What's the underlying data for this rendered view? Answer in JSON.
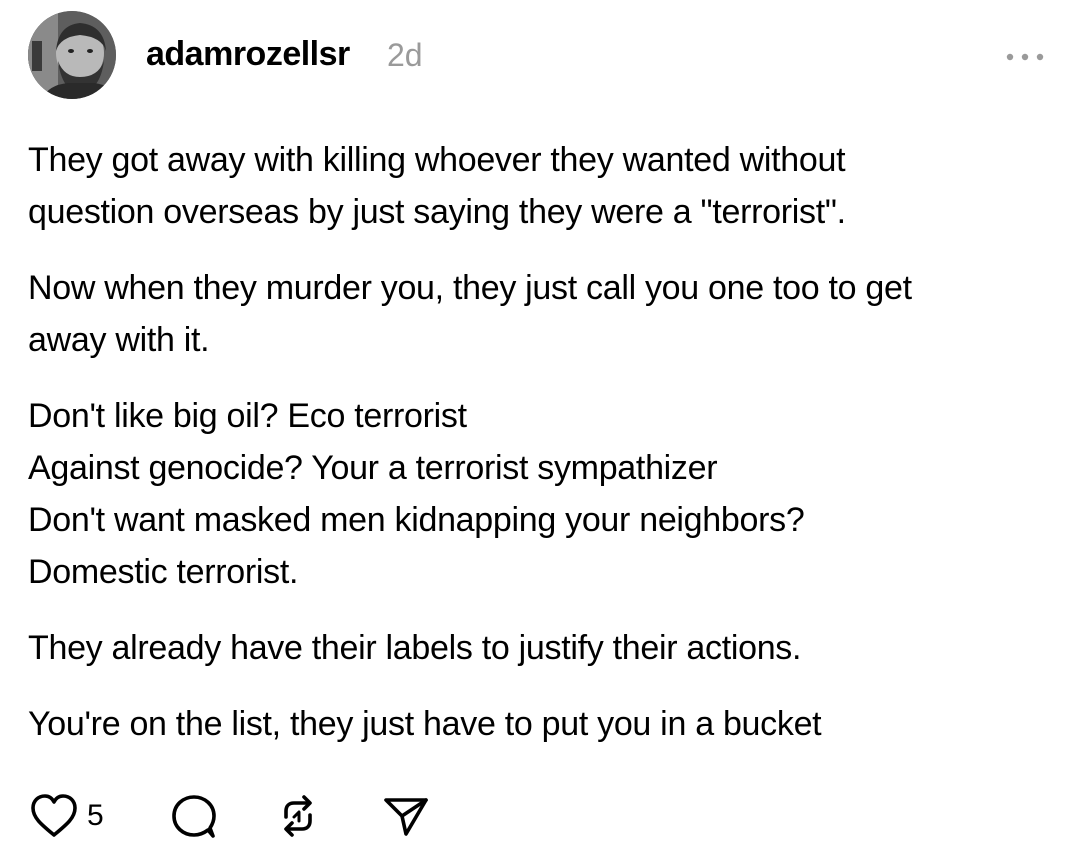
{
  "post": {
    "author": {
      "username": "adamrozellsr",
      "timestamp": "2d",
      "avatar_icon": "user-avatar"
    },
    "more_icon": "more-horizontal-icon",
    "paragraphs": [
      {
        "lines": [
          "They got away with killing whoever they wanted without",
          "question overseas by just saying they were a \"terrorist\"."
        ]
      },
      {
        "lines": [
          "Now when they murder you, they just call you one too to get",
          "away with it."
        ]
      },
      {
        "lines": [
          "Don't like big oil? Eco terrorist",
          "Against genocide? Your a terrorist sympathizer",
          "Don't want masked men kidnapping your neighbors?",
          "Domestic terrorist."
        ]
      },
      {
        "lines": [
          "They already have their labels to justify their actions."
        ]
      },
      {
        "lines": [
          "You're on the list, they just have to put you in a bucket"
        ]
      }
    ],
    "actions": {
      "like_icon": "heart-icon",
      "like_count": "5",
      "reply_icon": "comment-icon",
      "repost_icon": "repost-icon",
      "share_icon": "send-icon"
    },
    "colors": {
      "text": "#000000",
      "timestamp": "#9a9a9a",
      "more_dots": "#9a9a9a",
      "background": "#ffffff"
    }
  }
}
